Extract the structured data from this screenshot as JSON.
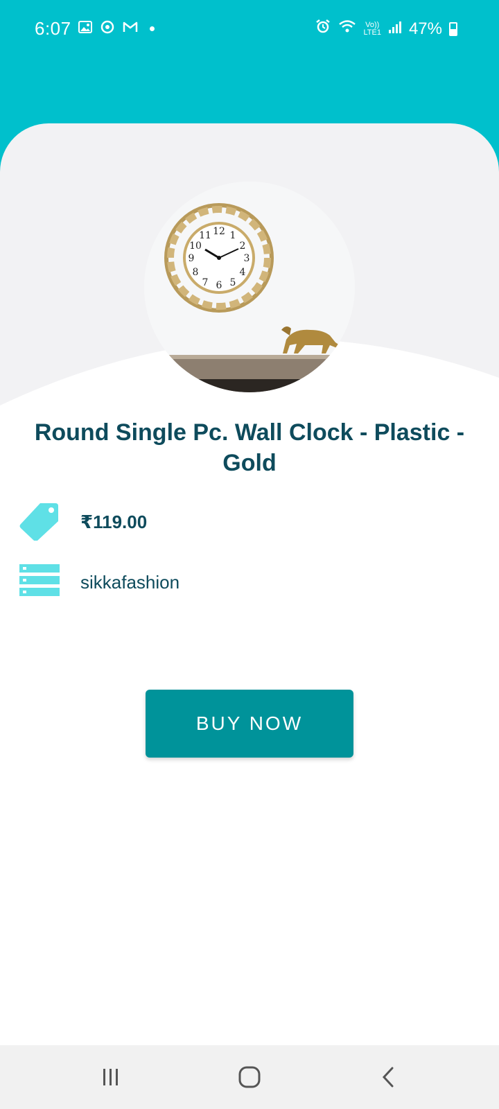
{
  "status_bar": {
    "time": "6:07",
    "battery": "47%",
    "network": "LTE1",
    "volte": "Vo))"
  },
  "product": {
    "title": "Round Single Pc. Wall Clock - Plastic - Gold",
    "price": "₹119.00",
    "seller": "sikkafashion",
    "image_icon": "wall-clock-image"
  },
  "actions": {
    "buy_label": "BUY NOW"
  },
  "colors": {
    "accent": "#00c0cc",
    "button": "#00939a",
    "title": "#0e4b5c",
    "icon": "#5fe0e6"
  },
  "icons": {
    "price": "price-tag-icon",
    "seller": "list-icon",
    "nav_recents": "recents-icon",
    "nav_home": "home-icon",
    "nav_back": "back-icon"
  }
}
